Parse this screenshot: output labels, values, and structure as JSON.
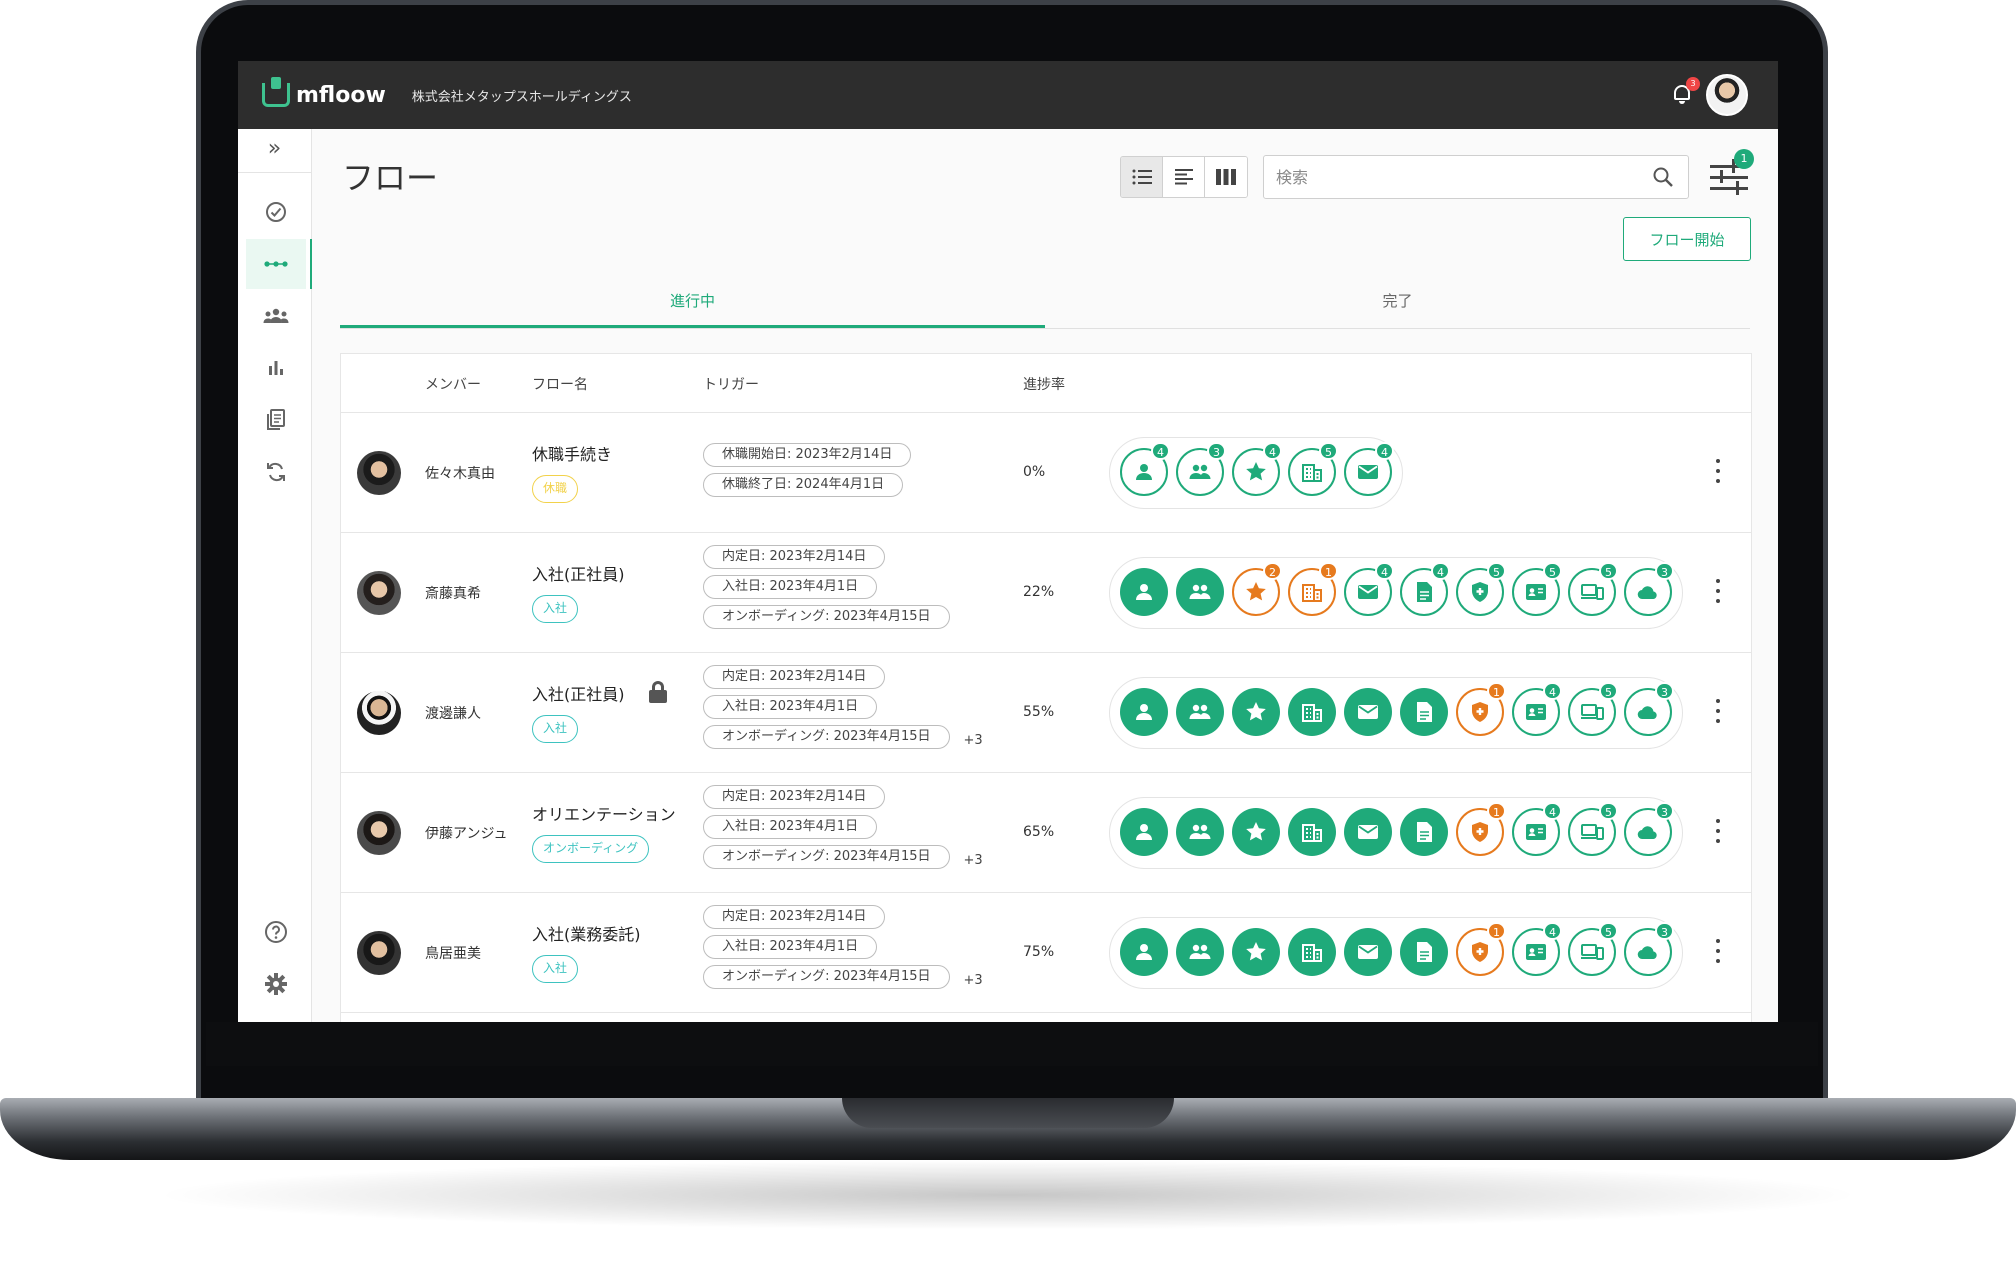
{
  "app": {
    "logo_text": "mfloow",
    "company": "株式会社メタップスホールディングス",
    "notification_count": "3"
  },
  "page": {
    "title": "フロー",
    "search_placeholder": "検索",
    "filter_count": "1",
    "start_button": "フロー開始"
  },
  "tabs": [
    {
      "label": "進行中",
      "active": true
    },
    {
      "label": "完了",
      "active": false
    }
  ],
  "table": {
    "headers": {
      "member": "メンバー",
      "flow": "フロー名",
      "trigger": "トリガー",
      "progress": "進捗率"
    },
    "rows": [
      {
        "name": "佐々木真由",
        "flow": "休職手続き",
        "locked": false,
        "tag": "休職",
        "tag_color": "#f2d24b",
        "triggers": [
          "休職開始日: 2023年2月14日",
          "休職終了日: 2024年4月1日"
        ],
        "more": "",
        "progress": "0%",
        "steps": [
          {
            "icon": "person-icon",
            "state": "todo",
            "badge": "4"
          },
          {
            "icon": "group-icon",
            "state": "todo",
            "badge": "3"
          },
          {
            "icon": "star-icon",
            "state": "todo",
            "badge": "4"
          },
          {
            "icon": "building-icon",
            "state": "todo",
            "badge": "5"
          },
          {
            "icon": "mail-icon",
            "state": "todo",
            "badge": "4"
          }
        ]
      },
      {
        "name": "斎藤真希",
        "flow": "入社(正社員)",
        "locked": false,
        "tag": "入社",
        "tag_color": "#3ec3c0",
        "triggers": [
          "内定日: 2023年2月14日",
          "入社日: 2023年4月1日",
          "オンボーディング: 2023年4月15日"
        ],
        "more": "",
        "progress": "22%",
        "steps": [
          {
            "icon": "person-icon",
            "state": "filled",
            "badge": ""
          },
          {
            "icon": "group-icon",
            "state": "filled",
            "badge": ""
          },
          {
            "icon": "star-icon",
            "state": "warn",
            "badge": "2"
          },
          {
            "icon": "building-icon",
            "state": "warn",
            "badge": "1"
          },
          {
            "icon": "mail-icon",
            "state": "todo",
            "badge": "4"
          },
          {
            "icon": "document-icon",
            "state": "todo",
            "badge": "4"
          },
          {
            "icon": "shield-icon",
            "state": "todo",
            "badge": "5"
          },
          {
            "icon": "id-card-icon",
            "state": "todo",
            "badge": "5"
          },
          {
            "icon": "devices-icon",
            "state": "todo",
            "badge": "5"
          },
          {
            "icon": "cloud-icon",
            "state": "todo",
            "badge": "3"
          }
        ]
      },
      {
        "name": "渡邊謙人",
        "flow": "入社(正社員)",
        "locked": true,
        "tag": "入社",
        "tag_color": "#3ec3c0",
        "triggers": [
          "内定日: 2023年2月14日",
          "入社日: 2023年4月1日",
          "オンボーディング: 2023年4月15日"
        ],
        "more": "+3",
        "progress": "55%",
        "steps": [
          {
            "icon": "person-icon",
            "state": "filled",
            "badge": ""
          },
          {
            "icon": "group-icon",
            "state": "filled",
            "badge": ""
          },
          {
            "icon": "star-icon",
            "state": "filled",
            "badge": ""
          },
          {
            "icon": "building-icon",
            "state": "filled",
            "badge": ""
          },
          {
            "icon": "mail-icon",
            "state": "filled",
            "badge": ""
          },
          {
            "icon": "document-icon",
            "state": "filled",
            "badge": ""
          },
          {
            "icon": "shield-icon",
            "state": "warn",
            "badge": "1"
          },
          {
            "icon": "id-card-icon",
            "state": "todo",
            "badge": "4"
          },
          {
            "icon": "devices-icon",
            "state": "todo",
            "badge": "5"
          },
          {
            "icon": "cloud-icon",
            "state": "todo",
            "badge": "3"
          }
        ]
      },
      {
        "name": "伊藤アンジュ",
        "flow": "オリエンテーション",
        "locked": false,
        "tag": "オンボーディング",
        "tag_color": "#3ec3c0",
        "triggers": [
          "内定日: 2023年2月14日",
          "入社日: 2023年4月1日",
          "オンボーディング: 2023年4月15日"
        ],
        "more": "+3",
        "progress": "65%",
        "steps": [
          {
            "icon": "person-icon",
            "state": "filled",
            "badge": ""
          },
          {
            "icon": "group-icon",
            "state": "filled",
            "badge": ""
          },
          {
            "icon": "star-icon",
            "state": "filled",
            "badge": ""
          },
          {
            "icon": "building-icon",
            "state": "filled",
            "badge": ""
          },
          {
            "icon": "mail-icon",
            "state": "filled",
            "badge": ""
          },
          {
            "icon": "document-icon",
            "state": "filled",
            "badge": ""
          },
          {
            "icon": "shield-icon",
            "state": "warn",
            "badge": "1"
          },
          {
            "icon": "id-card-icon",
            "state": "todo",
            "badge": "4"
          },
          {
            "icon": "devices-icon",
            "state": "todo",
            "badge": "5"
          },
          {
            "icon": "cloud-icon",
            "state": "todo",
            "badge": "3"
          }
        ]
      },
      {
        "name": "鳥居亜美",
        "flow": "入社(業務委託)",
        "locked": false,
        "tag": "入社",
        "tag_color": "#3ec3c0",
        "triggers": [
          "内定日: 2023年2月14日",
          "入社日: 2023年4月1日",
          "オンボーディング: 2023年4月15日"
        ],
        "more": "+3",
        "progress": "75%",
        "steps": [
          {
            "icon": "person-icon",
            "state": "filled",
            "badge": ""
          },
          {
            "icon": "group-icon",
            "state": "filled",
            "badge": ""
          },
          {
            "icon": "star-icon",
            "state": "filled",
            "badge": ""
          },
          {
            "icon": "building-icon",
            "state": "filled",
            "badge": ""
          },
          {
            "icon": "mail-icon",
            "state": "filled",
            "badge": ""
          },
          {
            "icon": "document-icon",
            "state": "filled",
            "badge": ""
          },
          {
            "icon": "shield-icon",
            "state": "warn",
            "badge": "1"
          },
          {
            "icon": "id-card-icon",
            "state": "todo",
            "badge": "4"
          },
          {
            "icon": "devices-icon",
            "state": "todo",
            "badge": "5"
          },
          {
            "icon": "cloud-icon",
            "state": "todo",
            "badge": "3"
          }
        ]
      }
    ]
  },
  "colors": {
    "accent": "#1faa7a",
    "warning": "#e67a1e",
    "appbar": "#2d2d2d"
  }
}
